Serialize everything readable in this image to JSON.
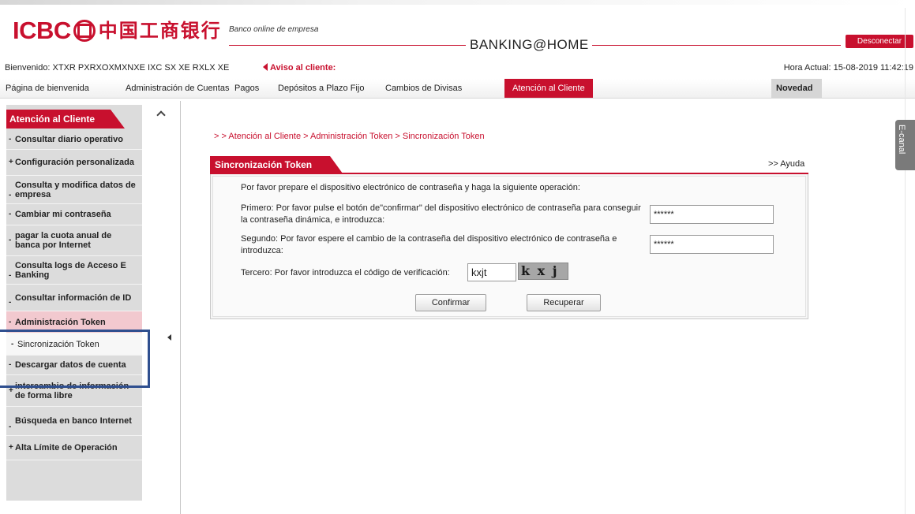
{
  "header": {
    "logo_icbc": "ICBC",
    "logo_chinese": "中国工商银行",
    "tagline": "Banco online de empresa",
    "brand": "BANKING@HOME",
    "logout_label": "Desconectar"
  },
  "info_bar": {
    "welcome": "Bienvenido: XTXR PXRXOXMXNXE IXC SX XE RXLX XE",
    "notice": "Aviso al cliente:",
    "clock": "Hora Actual: 15-08-2019 11:42:19"
  },
  "topnav": {
    "items": [
      "Página de bienvenida",
      "Administración de Cuentas",
      "Pagos",
      "Depósitos a Plazo Fijo",
      "Cambios de Divisas",
      "Atención al Cliente"
    ],
    "active_index": 5,
    "novedad": "Novedad"
  },
  "sidebar": {
    "title": "Atención al Cliente",
    "items": [
      {
        "label": "Consultar diario operativo",
        "bullet": "-"
      },
      {
        "label": "Configuración personalizada",
        "bullet": "+"
      },
      {
        "label": "Consulta y modifica datos de empresa",
        "bullet": "-"
      },
      {
        "label": "Cambiar mi contraseña",
        "bullet": "-"
      },
      {
        "label": "pagar la cuota anual de banca por Internet",
        "bullet": "-"
      },
      {
        "label": "Consulta logs de Acceso E Banking",
        "bullet": "-"
      },
      {
        "label": "Consultar información de ID",
        "bullet": "-"
      },
      {
        "label": "Administración Token",
        "bullet": "-"
      },
      {
        "label": "Sincronización Token",
        "bullet": "-"
      },
      {
        "label": "Descargar datos de cuenta",
        "bullet": "-"
      },
      {
        "label": "intercambio de información de forma libre",
        "bullet": "+"
      },
      {
        "label": "Búsqueda en banco Internet",
        "bullet": "-"
      },
      {
        "label": "Alta Límite de Operación",
        "bullet": "+"
      }
    ]
  },
  "breadcrumb": "> > Atención al Cliente > Administración Token > Sincronización Token",
  "help_link": ">> Ayuda",
  "panel": {
    "title": "Sincronización Token",
    "intro": "Por favor prepare el dispositivo electrónico de contraseña y haga la siguiente operación:",
    "step1": "Primero: Por favor pulse el botón de\"confirmar\" del dispositivo electrónico de contraseña para conseguir la contraseña dinámica, e introduzca:",
    "step1_value": "******",
    "step2": "Segundo: Por favor espere el cambio de la contraseña del dispositivo electrónico de contraseña e introduzca:",
    "step2_value": "******",
    "step3": "Tercero: Por favor introduzca el código de verificación:",
    "code_value": "kxjt",
    "captcha_text": "k x j t",
    "confirm_label": "Confirmar",
    "recover_label": "Recuperar"
  },
  "side_tab": "E-canal",
  "colors": {
    "brand_red": "#c8102e",
    "sidebar_bg": "#dcdcdc",
    "highlight_border": "#2f4f8f"
  }
}
